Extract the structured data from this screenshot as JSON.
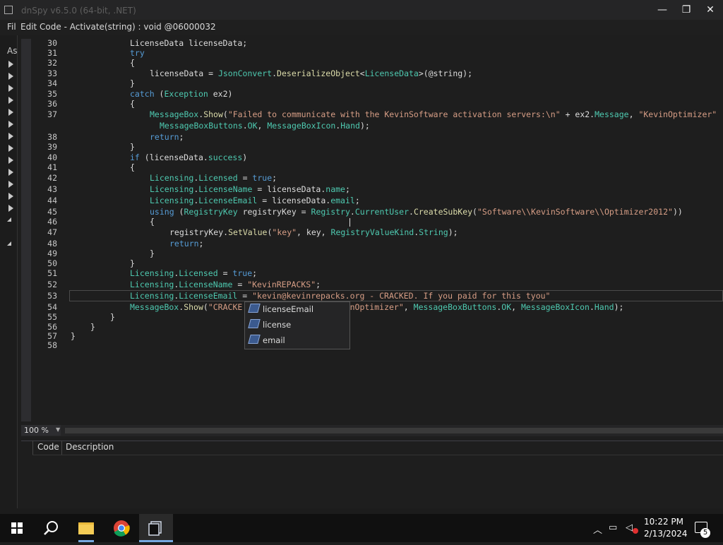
{
  "window": {
    "title": "dnSpy v6.5.0 (64-bit, .NET)",
    "minimize_glyph": "—",
    "maximize_glyph": "❐",
    "close_glyph": "✕"
  },
  "menu": {
    "partial_label": "Fil"
  },
  "left_panel": {
    "partial_label": "As"
  },
  "dialog": {
    "title": "Edit Code - Activate(string) : void @06000032"
  },
  "code_lines": [
    {
      "n": "30",
      "segs": [
        {
          "t": "LicenseData licenseData;",
          "c": "p"
        }
      ],
      "indent": 136
    },
    {
      "n": "31",
      "segs": [
        {
          "t": "try",
          "c": "k"
        }
      ],
      "indent": 136
    },
    {
      "n": "32",
      "segs": [
        {
          "t": "{",
          "c": "p"
        }
      ],
      "indent": 136
    },
    {
      "n": "33",
      "segs": [
        {
          "t": "licenseData = ",
          "c": "p"
        },
        {
          "t": "JsonConvert",
          "c": "t"
        },
        {
          "t": ".",
          "c": "p"
        },
        {
          "t": "DeserializeObject",
          "c": "m"
        },
        {
          "t": "<",
          "c": "p"
        },
        {
          "t": "LicenseData",
          "c": "t"
        },
        {
          "t": ">(@string);",
          "c": "p"
        }
      ],
      "indent": 164
    },
    {
      "n": "34",
      "segs": [
        {
          "t": "}",
          "c": "p"
        }
      ],
      "indent": 136
    },
    {
      "n": "35",
      "segs": [
        {
          "t": "catch",
          "c": "k"
        },
        {
          "t": " (",
          "c": "p"
        },
        {
          "t": "Exception",
          "c": "t"
        },
        {
          "t": " ex2)",
          "c": "p"
        }
      ],
      "indent": 136
    },
    {
      "n": "36",
      "segs": [
        {
          "t": "{",
          "c": "p"
        }
      ],
      "indent": 136
    },
    {
      "n": "37",
      "segs": [
        {
          "t": "MessageBox",
          "c": "t"
        },
        {
          "t": ".",
          "c": "p"
        },
        {
          "t": "Show",
          "c": "m"
        },
        {
          "t": "(",
          "c": "p"
        },
        {
          "t": "\"Failed to communicate with the KevinSoftware activation servers:\\n\"",
          "c": "s"
        },
        {
          "t": " + ex2.",
          "c": "p"
        },
        {
          "t": "Message",
          "c": "f"
        },
        {
          "t": ", ",
          "c": "p"
        },
        {
          "t": "\"KevinOptimizer\"",
          "c": "s"
        }
      ],
      "indent": 164
    },
    {
      "n": "",
      "segs": [
        {
          "t": "MessageBoxButtons",
          "c": "t"
        },
        {
          "t": ".",
          "c": "p"
        },
        {
          "t": "OK",
          "c": "f"
        },
        {
          "t": ", ",
          "c": "p"
        },
        {
          "t": "MessageBoxIcon",
          "c": "t"
        },
        {
          "t": ".",
          "c": "p"
        },
        {
          "t": "Hand",
          "c": "f"
        },
        {
          "t": ");",
          "c": "p"
        }
      ],
      "indent": 178
    },
    {
      "n": "38",
      "segs": [
        {
          "t": "return",
          "c": "k"
        },
        {
          "t": ";",
          "c": "p"
        }
      ],
      "indent": 164
    },
    {
      "n": "39",
      "segs": [
        {
          "t": "}",
          "c": "p"
        }
      ],
      "indent": 136
    },
    {
      "n": "40",
      "segs": [
        {
          "t": "if",
          "c": "k"
        },
        {
          "t": " (licenseData.",
          "c": "p"
        },
        {
          "t": "success",
          "c": "f"
        },
        {
          "t": ")",
          "c": "p"
        }
      ],
      "indent": 136
    },
    {
      "n": "41",
      "segs": [
        {
          "t": "{",
          "c": "p"
        }
      ],
      "indent": 136
    },
    {
      "n": "42",
      "segs": [
        {
          "t": "Licensing",
          "c": "t"
        },
        {
          "t": ".",
          "c": "p"
        },
        {
          "t": "Licensed",
          "c": "f"
        },
        {
          "t": " = ",
          "c": "p"
        },
        {
          "t": "true",
          "c": "k"
        },
        {
          "t": ";",
          "c": "p"
        }
      ],
      "indent": 164
    },
    {
      "n": "43",
      "segs": [
        {
          "t": "Licensing",
          "c": "t"
        },
        {
          "t": ".",
          "c": "p"
        },
        {
          "t": "LicenseName",
          "c": "f"
        },
        {
          "t": " = licenseData.",
          "c": "p"
        },
        {
          "t": "name",
          "c": "f"
        },
        {
          "t": ";",
          "c": "p"
        }
      ],
      "indent": 164
    },
    {
      "n": "44",
      "segs": [
        {
          "t": "Licensing",
          "c": "t"
        },
        {
          "t": ".",
          "c": "p"
        },
        {
          "t": "LicenseEmail",
          "c": "f"
        },
        {
          "t": " = licenseData.",
          "c": "p"
        },
        {
          "t": "email",
          "c": "f"
        },
        {
          "t": ";",
          "c": "p"
        }
      ],
      "indent": 164
    },
    {
      "n": "45",
      "segs": [
        {
          "t": "using",
          "c": "k"
        },
        {
          "t": " (",
          "c": "p"
        },
        {
          "t": "RegistryKey",
          "c": "t"
        },
        {
          "t": " registryKey = ",
          "c": "p"
        },
        {
          "t": "Registry",
          "c": "t"
        },
        {
          "t": ".",
          "c": "p"
        },
        {
          "t": "CurrentUser",
          "c": "f"
        },
        {
          "t": ".",
          "c": "p"
        },
        {
          "t": "CreateSubKey",
          "c": "m"
        },
        {
          "t": "(",
          "c": "p"
        },
        {
          "t": "\"Software\\\\KevinSoftware\\\\Optimizer2012\"",
          "c": "s"
        },
        {
          "t": "))",
          "c": "p"
        }
      ],
      "indent": 164
    },
    {
      "n": "46",
      "segs": [
        {
          "t": "{",
          "c": "p"
        }
      ],
      "indent": 164
    },
    {
      "n": "47",
      "segs": [
        {
          "t": "registryKey.",
          "c": "p"
        },
        {
          "t": "SetValue",
          "c": "m"
        },
        {
          "t": "(",
          "c": "p"
        },
        {
          "t": "\"key\"",
          "c": "s"
        },
        {
          "t": ", key, ",
          "c": "p"
        },
        {
          "t": "RegistryValueKind",
          "c": "t"
        },
        {
          "t": ".",
          "c": "p"
        },
        {
          "t": "String",
          "c": "f"
        },
        {
          "t": ");",
          "c": "p"
        }
      ],
      "indent": 192
    },
    {
      "n": "48",
      "segs": [
        {
          "t": "return",
          "c": "k"
        },
        {
          "t": ";",
          "c": "p"
        }
      ],
      "indent": 192
    },
    {
      "n": "49",
      "segs": [
        {
          "t": "}",
          "c": "p"
        }
      ],
      "indent": 164
    },
    {
      "n": "50",
      "segs": [
        {
          "t": "}",
          "c": "p"
        }
      ],
      "indent": 136
    },
    {
      "n": "51",
      "segs": [
        {
          "t": "Licensing",
          "c": "t"
        },
        {
          "t": ".",
          "c": "p"
        },
        {
          "t": "Licensed",
          "c": "f"
        },
        {
          "t": " = ",
          "c": "p"
        },
        {
          "t": "true",
          "c": "k"
        },
        {
          "t": ";",
          "c": "p"
        }
      ],
      "indent": 136
    },
    {
      "n": "52",
      "segs": [
        {
          "t": "Licensing",
          "c": "t"
        },
        {
          "t": ".",
          "c": "p"
        },
        {
          "t": "LicenseName",
          "c": "f"
        },
        {
          "t": " = ",
          "c": "p"
        },
        {
          "t": "\"KevinREPACKS\"",
          "c": "s"
        },
        {
          "t": ";",
          "c": "p"
        }
      ],
      "indent": 136
    },
    {
      "n": "53",
      "segs": [
        {
          "t": "Licensing",
          "c": "t"
        },
        {
          "t": ".",
          "c": "p"
        },
        {
          "t": "LicenseEmail",
          "c": "f"
        },
        {
          "t": " = ",
          "c": "p"
        },
        {
          "t": "\"kevin@kevinrepacks.org - CRACKED. If you paid for this tyou\"",
          "c": "s"
        }
      ],
      "indent": 136,
      "current": true
    },
    {
      "n": "54",
      "segs": [
        {
          "t": "MessageBox",
          "c": "t"
        },
        {
          "t": ".",
          "c": "p"
        },
        {
          "t": "Show",
          "c": "m"
        },
        {
          "t": "(",
          "c": "p"
        },
        {
          "t": "\"CRACKE",
          "c": "s"
        },
        {
          "t": "                  ",
          "c": "p"
        },
        {
          "t": "KevinOptimizer\"",
          "c": "s"
        },
        {
          "t": ", ",
          "c": "p"
        },
        {
          "t": "MessageBoxButtons",
          "c": "t"
        },
        {
          "t": ".",
          "c": "p"
        },
        {
          "t": "OK",
          "c": "f"
        },
        {
          "t": ", ",
          "c": "p"
        },
        {
          "t": "MessageBoxIcon",
          "c": "t"
        },
        {
          "t": ".",
          "c": "p"
        },
        {
          "t": "Hand",
          "c": "f"
        },
        {
          "t": ");",
          "c": "p"
        }
      ],
      "indent": 136
    },
    {
      "n": "55",
      "segs": [
        {
          "t": "}",
          "c": "p"
        }
      ],
      "indent": 108
    },
    {
      "n": "56",
      "segs": [
        {
          "t": "}",
          "c": "p"
        }
      ],
      "indent": 80
    },
    {
      "n": "57",
      "segs": [
        {
          "t": "}",
          "c": "p"
        }
      ],
      "indent": 52
    },
    {
      "n": "58",
      "segs": [],
      "indent": 52
    }
  ],
  "autocomplete": {
    "items": [
      "licenseEmail",
      "license",
      "email"
    ]
  },
  "zoom": {
    "level": "100 %"
  },
  "error_list": {
    "col_code": "Code",
    "col_description": "Description"
  },
  "taskbar": {
    "time": "10:22 PM",
    "date": "2/13/2024",
    "notification_count": "5"
  }
}
